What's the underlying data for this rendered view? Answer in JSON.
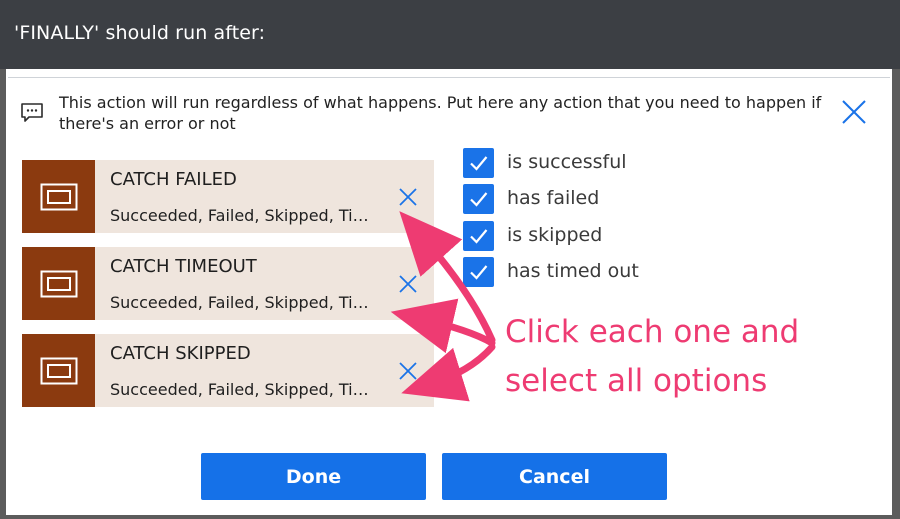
{
  "dialog": {
    "title": "'FINALLY' should run after:"
  },
  "info": {
    "text": "This action will run regardless of what happens. Put here any action that you need to happen if there's an error or not",
    "icon": "comment-icon"
  },
  "actions": [
    {
      "name": "CATCH FAILED",
      "status": "Succeeded, Failed, Skipped, Ti…"
    },
    {
      "name": "CATCH TIMEOUT",
      "status": "Succeeded, Failed, Skipped, Ti…"
    },
    {
      "name": "CATCH SKIPPED",
      "status": "Succeeded, Failed, Skipped, Ti…"
    }
  ],
  "conditions": [
    {
      "label": "is successful",
      "checked": true
    },
    {
      "label": "has failed",
      "checked": true
    },
    {
      "label": "is skipped",
      "checked": true
    },
    {
      "label": "has timed out",
      "checked": true
    }
  ],
  "annotation": {
    "line1": "Click each one and",
    "line2": "select all options"
  },
  "buttons": {
    "done": "Done",
    "cancel": "Cancel"
  },
  "colors": {
    "titlebar": "#3c3f44",
    "accent": "#1571e8",
    "action_tile": "#8b3a0f",
    "action_bg": "#efe5dd",
    "annotation": "#ee3b72"
  }
}
